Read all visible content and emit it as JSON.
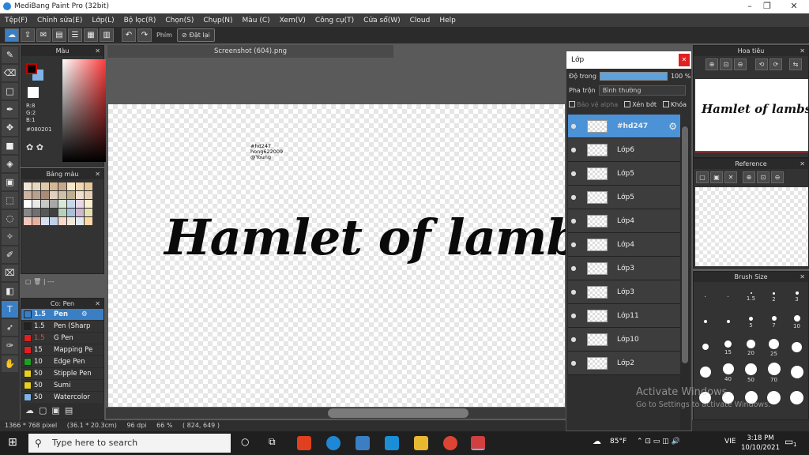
{
  "window": {
    "title": "MediBang Paint Pro (32bit)"
  },
  "menu": [
    "Tệp(F)",
    "Chỉnh sửa(E)",
    "Lớp(L)",
    "Bộ lọc(R)",
    "Chọn(S)",
    "Chụp(N)",
    "Màu (C)",
    "Xem(V)",
    "Công cụ(T)",
    "Cửa sổ(W)",
    "Cloud",
    "Help"
  ],
  "toolbar": {
    "shortcut_label": "Phím",
    "reset_label": "Đặt lại"
  },
  "color_panel": {
    "title": "Màu",
    "r": "R:8",
    "g": "G:2",
    "b": "B:1",
    "hex": "#080201",
    "primary_color": "#080201",
    "secondary_color": "#7fb2e5"
  },
  "palette_panel": {
    "title": "Bảng màu",
    "status": "| ---"
  },
  "brush_panel": {
    "title": "Co: Pen",
    "items": [
      {
        "size": "1.5",
        "name": "Pen",
        "color": "#3a7fc4"
      },
      {
        "size": "1.5",
        "name": "Pen (Sharp",
        "color": "#222222"
      },
      {
        "size": "1.5",
        "name": "G Pen",
        "color": "#e02020"
      },
      {
        "size": "15",
        "name": "Mapping Pe",
        "color": "#e02020"
      },
      {
        "size": "10",
        "name": "Edge Pen",
        "color": "#20a020"
      },
      {
        "size": "50",
        "name": "Stipple Pen",
        "color": "#e8d020"
      },
      {
        "size": "50",
        "name": "Sumi",
        "color": "#e8d020"
      },
      {
        "size": "50",
        "name": "Watercolor",
        "color": "#7fb2e5"
      }
    ]
  },
  "document": {
    "tab": "Screenshot (604).png",
    "credit": [
      "#hd247",
      "hong622009",
      "@Young"
    ],
    "artwork_text": "Hamlet of lambs"
  },
  "status_bar": {
    "size": "1366 * 768 pixel",
    "physical": "(36.1 * 20.3cm)",
    "dpi": "96 dpi",
    "zoom": "66 %",
    "coords": "( 824, 649 )"
  },
  "layer_panel": {
    "title": "Lớp",
    "opacity_label": "Độ trong",
    "opacity_value": "100 %",
    "opacity_fraction": 1.0,
    "blend_label": "Pha trộn",
    "blend_value": "Bình thường",
    "protect_alpha": "Bảo vệ alpha",
    "clipping": "Xén bớt",
    "lock": "Khóa",
    "layers": [
      {
        "name": "#hd247",
        "selected": true
      },
      {
        "name": "Lớp6",
        "selected": false
      },
      {
        "name": "Lớp5",
        "selected": false
      },
      {
        "name": "Lớp5",
        "selected": false
      },
      {
        "name": "Lớp4",
        "selected": false
      },
      {
        "name": "Lớp4",
        "selected": false
      },
      {
        "name": "Lớp3",
        "selected": false
      },
      {
        "name": "Lớp3",
        "selected": false
      },
      {
        "name": "Lớp11",
        "selected": false
      },
      {
        "name": "Lớp10",
        "selected": false
      },
      {
        "name": "Lớp2",
        "selected": false
      }
    ]
  },
  "navigator": {
    "title": "Hoa tiêu",
    "preview_text": "Hamlet of lambs"
  },
  "reference": {
    "title": "Reference"
  },
  "brush_size": {
    "title": "Brush Size",
    "sizes": [
      "",
      "",
      "1.5",
      "2",
      "3",
      "",
      "",
      "5",
      "7",
      "10",
      "",
      "15",
      "20",
      "25",
      "",
      "",
      "40",
      "50",
      "70",
      "",
      "",
      "",
      "",
      "",
      ""
    ]
  },
  "watermark": {
    "line1": "Activate Windows",
    "line2": "Go to Settings to activate Windows."
  },
  "taskbar": {
    "search": "Type here to search",
    "weather": "85°F",
    "lang": "VIE",
    "time": "3:18 PM",
    "date": "10/10/2021",
    "notifications": "1"
  }
}
